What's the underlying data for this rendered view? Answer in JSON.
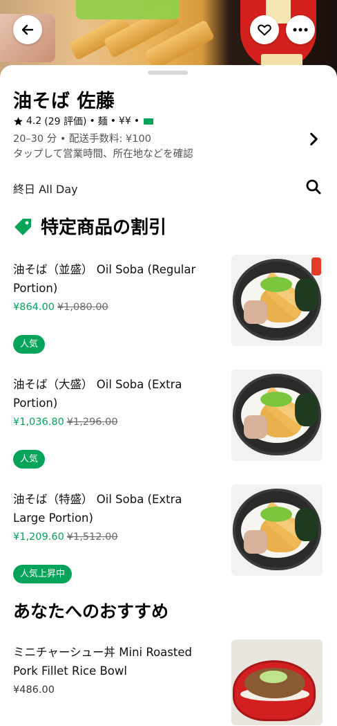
{
  "hero": {
    "icons": {
      "back": "arrow-left-icon",
      "favorite": "heart-icon",
      "more": "more-horizontal-icon"
    }
  },
  "store": {
    "name": "油そば 佐藤",
    "rating": "4.2",
    "reviews": "(29 評価)",
    "category": "麺",
    "price_level": "¥¥",
    "delivery_time": "20–30 分",
    "delivery_fee": "配送手数料: ¥100",
    "info_hint": "タップして営業時間、所在地などを確認",
    "menu_hours": "終日 All Day"
  },
  "promo_section": {
    "title": "特定商品の割引"
  },
  "promo_items": [
    {
      "name": "油そば（並盛） Oil Soba (Regular Portion)",
      "sale_price": "¥864.00",
      "orig_price": "¥1,080.00",
      "badge": "人気"
    },
    {
      "name": "油そば（大盛） Oil Soba (Extra Portion)",
      "sale_price": "¥1,036.80",
      "orig_price": "¥1,296.00",
      "badge": "人気"
    },
    {
      "name": "油そば（特盛） Oil Soba (Extra Large Portion)",
      "sale_price": "¥1,209.60",
      "orig_price": "¥1,512.00",
      "badge": "人気上昇中"
    }
  ],
  "recommend_section": {
    "title": "あなたへのおすすめ"
  },
  "recommend_items": [
    {
      "name": "ミニチャーシュー丼 Mini Roasted Pork Fillet Rice Bowl",
      "price": "¥486.00"
    }
  ],
  "colors": {
    "accent_green": "#06a35b",
    "text_gray": "#545454"
  }
}
